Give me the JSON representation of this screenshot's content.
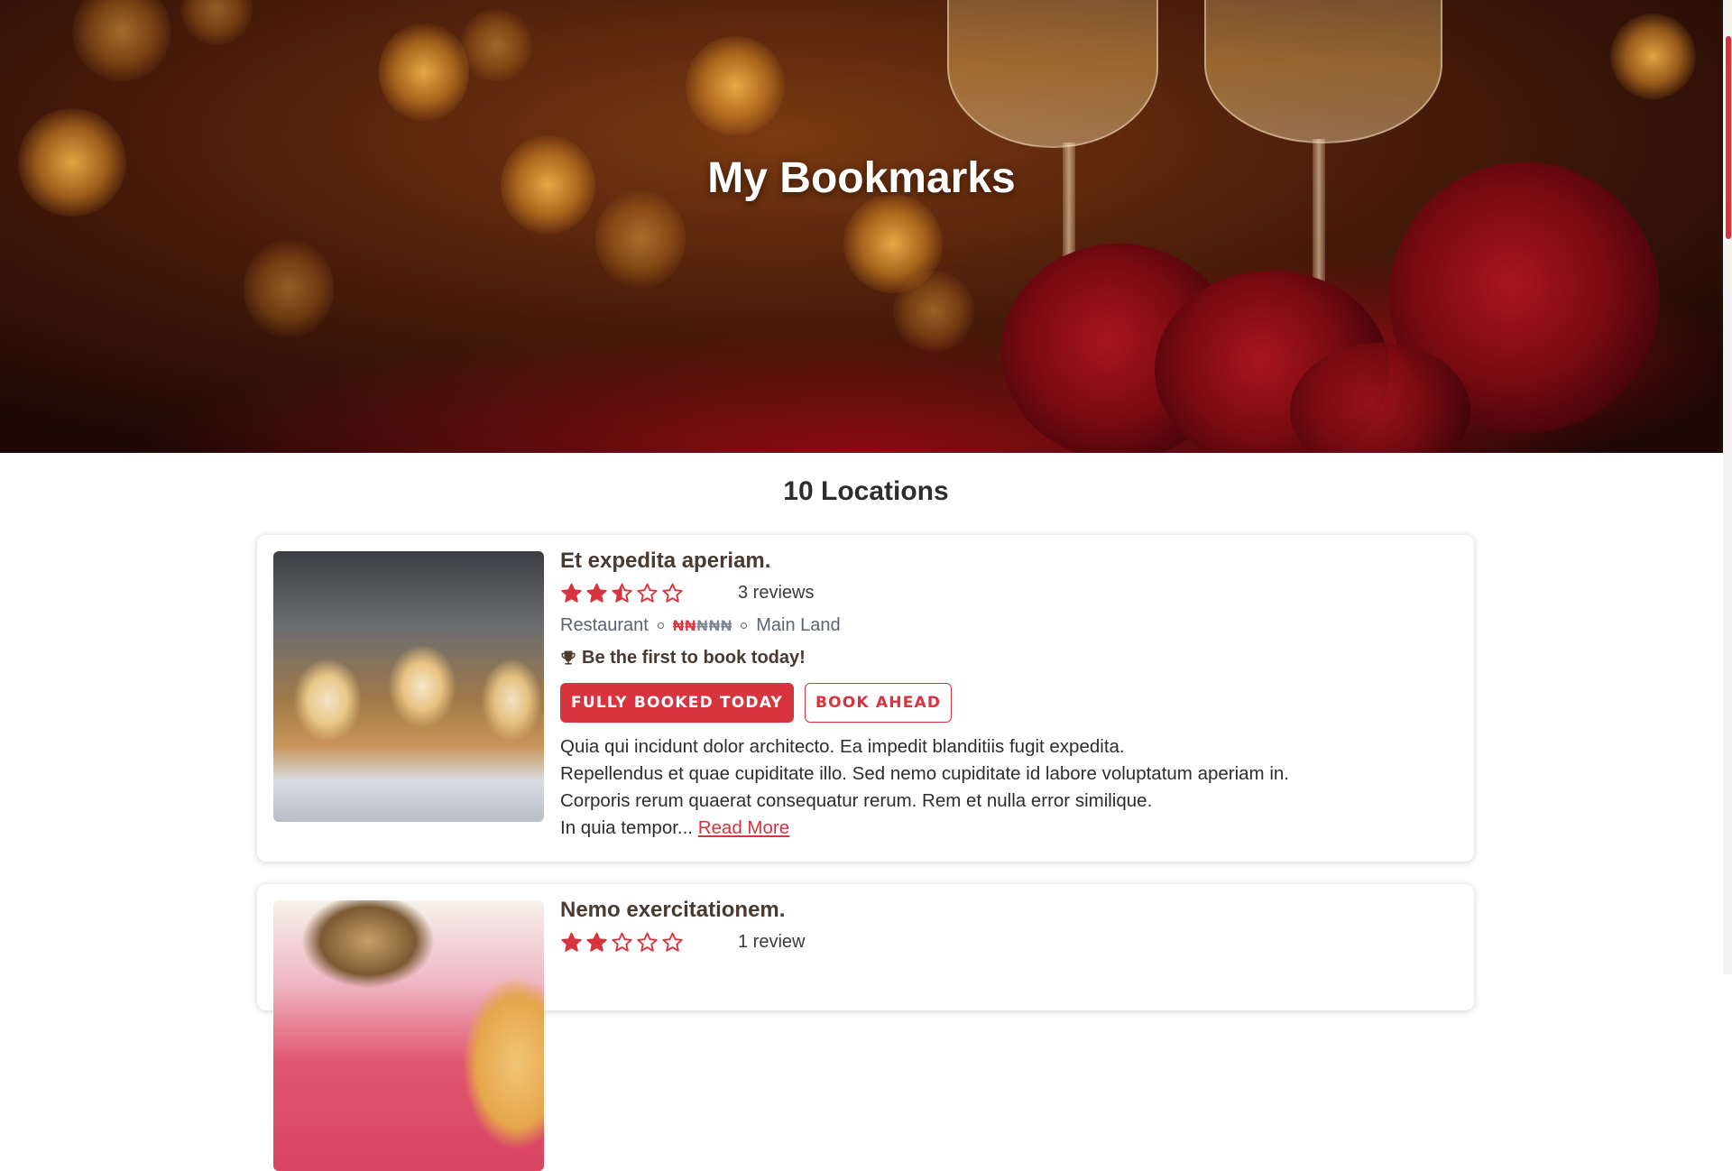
{
  "hero": {
    "title": "My Bookmarks"
  },
  "results": {
    "count_label": "10 Locations"
  },
  "colors": {
    "accent": "#d8343f",
    "price_inactive": "#7a8694"
  },
  "listings": [
    {
      "name": "Et expedita aperiam.",
      "rating": 2.5,
      "max_rating": 5,
      "reviews_label": "3 reviews",
      "category": "Restaurant",
      "price_level": 2,
      "price_symbol": "₦",
      "location": "Main Land",
      "highlight": "Be the first to book today!",
      "booked_button": "FULLY BOOKED TODAY",
      "book_ahead_button": "BOOK AHEAD",
      "description_lines": [
        "Quia qui incidunt dolor architecto. Ea impedit blanditiis fugit expedita.",
        "Repellendus et quae cupiditate illo. Sed nemo cupiditate id labore voluptatum aperiam in.",
        "Corporis rerum quaerat consequatur rerum. Rem et nulla error similique.",
        "In quia tempor..."
      ],
      "read_more": "Read More"
    },
    {
      "name": "Nemo exercitationem.",
      "rating": 2,
      "max_rating": 5,
      "reviews_label": "1 review"
    }
  ]
}
